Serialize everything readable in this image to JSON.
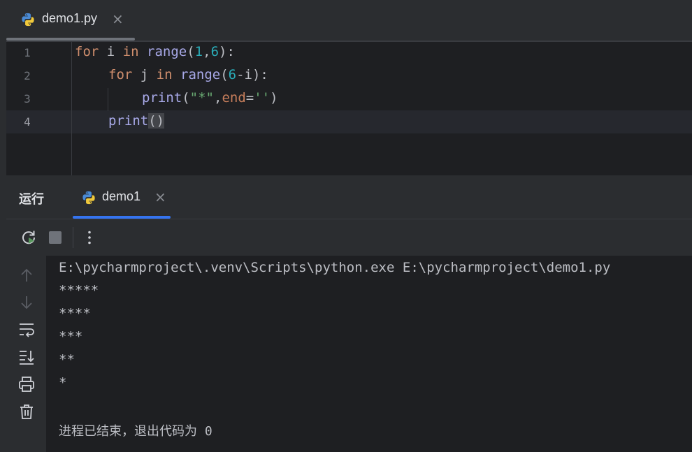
{
  "editor_tab": {
    "filename": "demo1.py",
    "icon": "python-icon",
    "close_glyph": "×"
  },
  "gutter": [
    "1",
    "2",
    "3",
    "4"
  ],
  "code": [
    [
      {
        "t": "for",
        "c": "kw"
      },
      {
        "t": " i ",
        "c": ""
      },
      {
        "t": "in",
        "c": "kw"
      },
      {
        "t": " ",
        "c": ""
      },
      {
        "t": "range",
        "c": "fn"
      },
      {
        "t": "(",
        "c": ""
      },
      {
        "t": "1",
        "c": "num"
      },
      {
        "t": ",",
        "c": ""
      },
      {
        "t": "6",
        "c": "num"
      },
      {
        "t": "):",
        "c": ""
      }
    ],
    [
      {
        "t": "for",
        "c": "kw"
      },
      {
        "t": " j ",
        "c": ""
      },
      {
        "t": "in",
        "c": "kw"
      },
      {
        "t": " ",
        "c": ""
      },
      {
        "t": "range",
        "c": "fn"
      },
      {
        "t": "(",
        "c": ""
      },
      {
        "t": "6",
        "c": "num"
      },
      {
        "t": "-i):",
        "c": ""
      }
    ],
    [
      {
        "t": "print",
        "c": "fn"
      },
      {
        "t": "(",
        "c": ""
      },
      {
        "t": "\"*\"",
        "c": "str"
      },
      {
        "t": ",",
        "c": ""
      },
      {
        "t": "end",
        "c": "param"
      },
      {
        "t": "=",
        "c": ""
      },
      {
        "t": "''",
        "c": "str"
      },
      {
        "t": ")",
        "c": ""
      }
    ],
    [
      {
        "t": "print",
        "c": "fn"
      },
      {
        "t": "()",
        "c": "paren-hl"
      }
    ]
  ],
  "run_panel": {
    "title": "运行",
    "tab_label": "demo1",
    "tab_icon": "python-icon",
    "close_glyph": "×"
  },
  "toolbar": {
    "rerun_icon": "rerun-icon",
    "stop_icon": "stop-icon",
    "more_glyph": "⋮"
  },
  "side_icons": [
    "arrow-up-icon",
    "arrow-down-icon",
    "soft-wrap-icon",
    "scroll-to-end-icon",
    "print-icon",
    "trash-icon"
  ],
  "console": {
    "command": "E:\\pycharmproject\\.venv\\Scripts\\python.exe E:\\pycharmproject\\demo1.py",
    "output": [
      "*****",
      "****",
      "***",
      "**",
      "*"
    ],
    "exit_message": "进程已结束，退出代码为 0"
  },
  "colors": {
    "background": "#1e1f22",
    "panel": "#2b2d30",
    "keyword": "#cf8e6d",
    "function": "#a8a9e8",
    "number": "#2aacb8",
    "string": "#6aab73",
    "accent": "#3574f0"
  }
}
